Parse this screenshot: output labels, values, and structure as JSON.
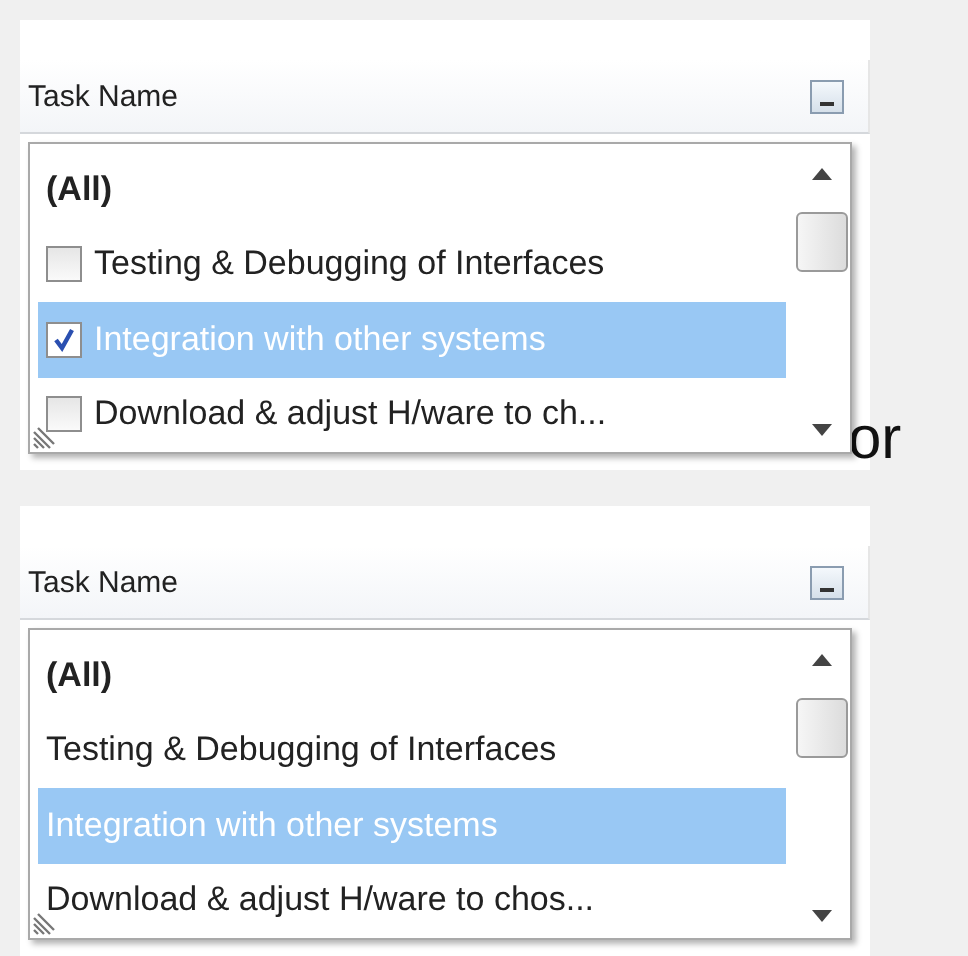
{
  "panels": [
    {
      "kind": "checklist",
      "header": "Task Name",
      "items": [
        {
          "kind": "all",
          "label": "(All)",
          "selected": false
        },
        {
          "kind": "item",
          "label": "Testing & Debugging of Interfaces",
          "checked": false,
          "selected": false
        },
        {
          "kind": "item",
          "label": "Integration with other systems",
          "checked": true,
          "selected": true
        },
        {
          "kind": "item",
          "label": "Download & adjust H/ware to ch...",
          "checked": false,
          "selected": false
        }
      ]
    },
    {
      "kind": "list",
      "header": "Task Name",
      "items": [
        {
          "kind": "all",
          "label": "(All)",
          "selected": false
        },
        {
          "kind": "item",
          "label": "Testing & Debugging of Interfaces",
          "selected": false
        },
        {
          "kind": "item",
          "label": "Integration with other systems",
          "selected": true
        },
        {
          "kind": "item",
          "label": "Download & adjust H/ware to chos...",
          "selected": false
        }
      ]
    }
  ],
  "separator": "or"
}
